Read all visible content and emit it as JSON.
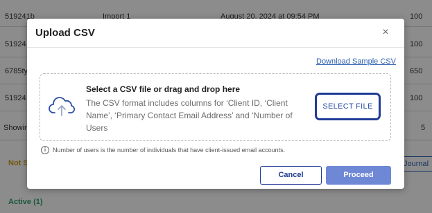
{
  "background": {
    "rows": [
      {
        "id": "519241b",
        "name": "Import 1",
        "date": "August 20, 2024 at 09:54 PM",
        "users": "100"
      },
      {
        "id": "51924",
        "name": "",
        "date": "",
        "users": "100"
      },
      {
        "id": "6785ty",
        "name": "",
        "date": "",
        "users": "650"
      },
      {
        "id": "51924",
        "name": "",
        "date": "",
        "users": "100"
      }
    ],
    "showing_label": "Showin",
    "showing_right": "5",
    "not_started_label": "Not S",
    "journal_button": "Journal",
    "active_label": "Active (1)"
  },
  "modal": {
    "title": "Upload CSV",
    "close_icon": "close-icon",
    "download_link": "Download Sample CSV",
    "dropzone": {
      "title": "Select a CSV file or drag and drop here",
      "description": "The CSV format includes columns for ‘Client ID, ‘Client Name’, ‘Primary Contact Email Address’ and ‘Number of Users",
      "select_button": "SELECT FILE",
      "icon": "cloud-upload-icon"
    },
    "info_note": "Number of users is the number of individuals that have client-issued email accounts.",
    "cancel_button": "Cancel",
    "proceed_button": "Proceed"
  },
  "colors": {
    "accent": "#1f3b94",
    "proceed_bg": "#6f88d6",
    "not_started": "#d4a017",
    "active": "#2e9e6b"
  }
}
